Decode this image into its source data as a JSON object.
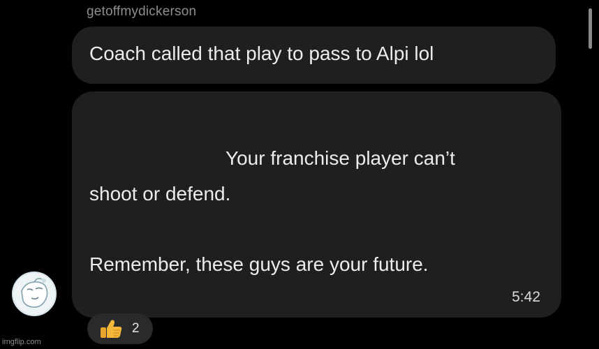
{
  "message_group": {
    "sender": "getoffmydickerson",
    "messages": [
      {
        "text": "Coach called that play to pass to Alpi lol"
      },
      {
        "lines": [
          "Your franchise player can’t",
          "shoot or defend.",
          "Remember, these guys are your future."
        ],
        "timestamp": "5:42"
      }
    ],
    "reaction": {
      "icon": "thumbs-up-icon",
      "count": "2"
    }
  },
  "watermark": "imgflip.com",
  "colors": {
    "background": "#000000",
    "bubble": "#1f1f21",
    "sender_text": "#8e8e92",
    "reaction_pill": "#2a2a2c",
    "thumb": "#f4b73a"
  }
}
